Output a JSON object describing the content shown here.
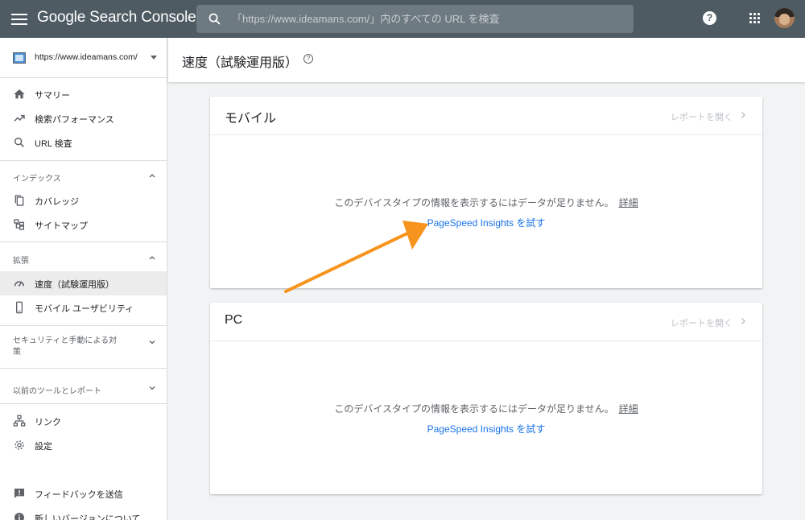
{
  "app": {
    "name": "Google Search Console",
    "search_placeholder": "「https://www.ideamans.com/」内のすべての URL を検査",
    "help_glyph": "?"
  },
  "sidebar": {
    "property_url": "https://www.ideamans.com/",
    "top_items": [
      {
        "label": "サマリー",
        "icon": "home-icon"
      },
      {
        "label": "検索パフォーマンス",
        "icon": "trending-up-icon"
      },
      {
        "label": "URL 検査",
        "icon": "search-icon"
      }
    ],
    "sections": [
      {
        "label": "インデックス",
        "expanded": true,
        "items": [
          {
            "label": "カバレッジ",
            "icon": "copy-icon"
          },
          {
            "label": "サイトマップ",
            "icon": "sitemap-icon"
          }
        ]
      },
      {
        "label": "拡張",
        "expanded": true,
        "items": [
          {
            "label": "速度（試験運用版）",
            "icon": "speed-icon",
            "active": true
          },
          {
            "label": "モバイル ユーザビリティ",
            "icon": "phone-icon"
          }
        ]
      },
      {
        "label_line1": "セキュリティと手動による対",
        "label_line2": "策",
        "expanded": false
      },
      {
        "label": "以前のツールとレポート",
        "expanded": false
      }
    ],
    "bottom_items": [
      {
        "label": "リンク",
        "icon": "links-icon"
      },
      {
        "label": "設定",
        "icon": "settings-icon"
      },
      {
        "label": "フィードバックを送信",
        "icon": "feedback-icon"
      },
      {
        "label": "新しいバージョンについて",
        "icon": "info-icon"
      }
    ]
  },
  "page": {
    "title": "速度（試験運用版）",
    "help_glyph": "?"
  },
  "cards": [
    {
      "title": "モバイル",
      "open_report": "レポートを開く",
      "message": "このデバイスタイプの情報を表示するにはデータが足りません。",
      "detail": "詳細",
      "link": "PageSpeed Insights を試す"
    },
    {
      "title": "PC",
      "open_report": "レポートを開く",
      "message": "このデバイスタイプの情報を表示するにはデータが足りません。",
      "detail": "詳細",
      "link": "PageSpeed Insights を試す"
    }
  ],
  "colors": {
    "topbar": "#4e5b63",
    "link": "#1a73e8",
    "annotation_arrow": "#f7941d"
  }
}
